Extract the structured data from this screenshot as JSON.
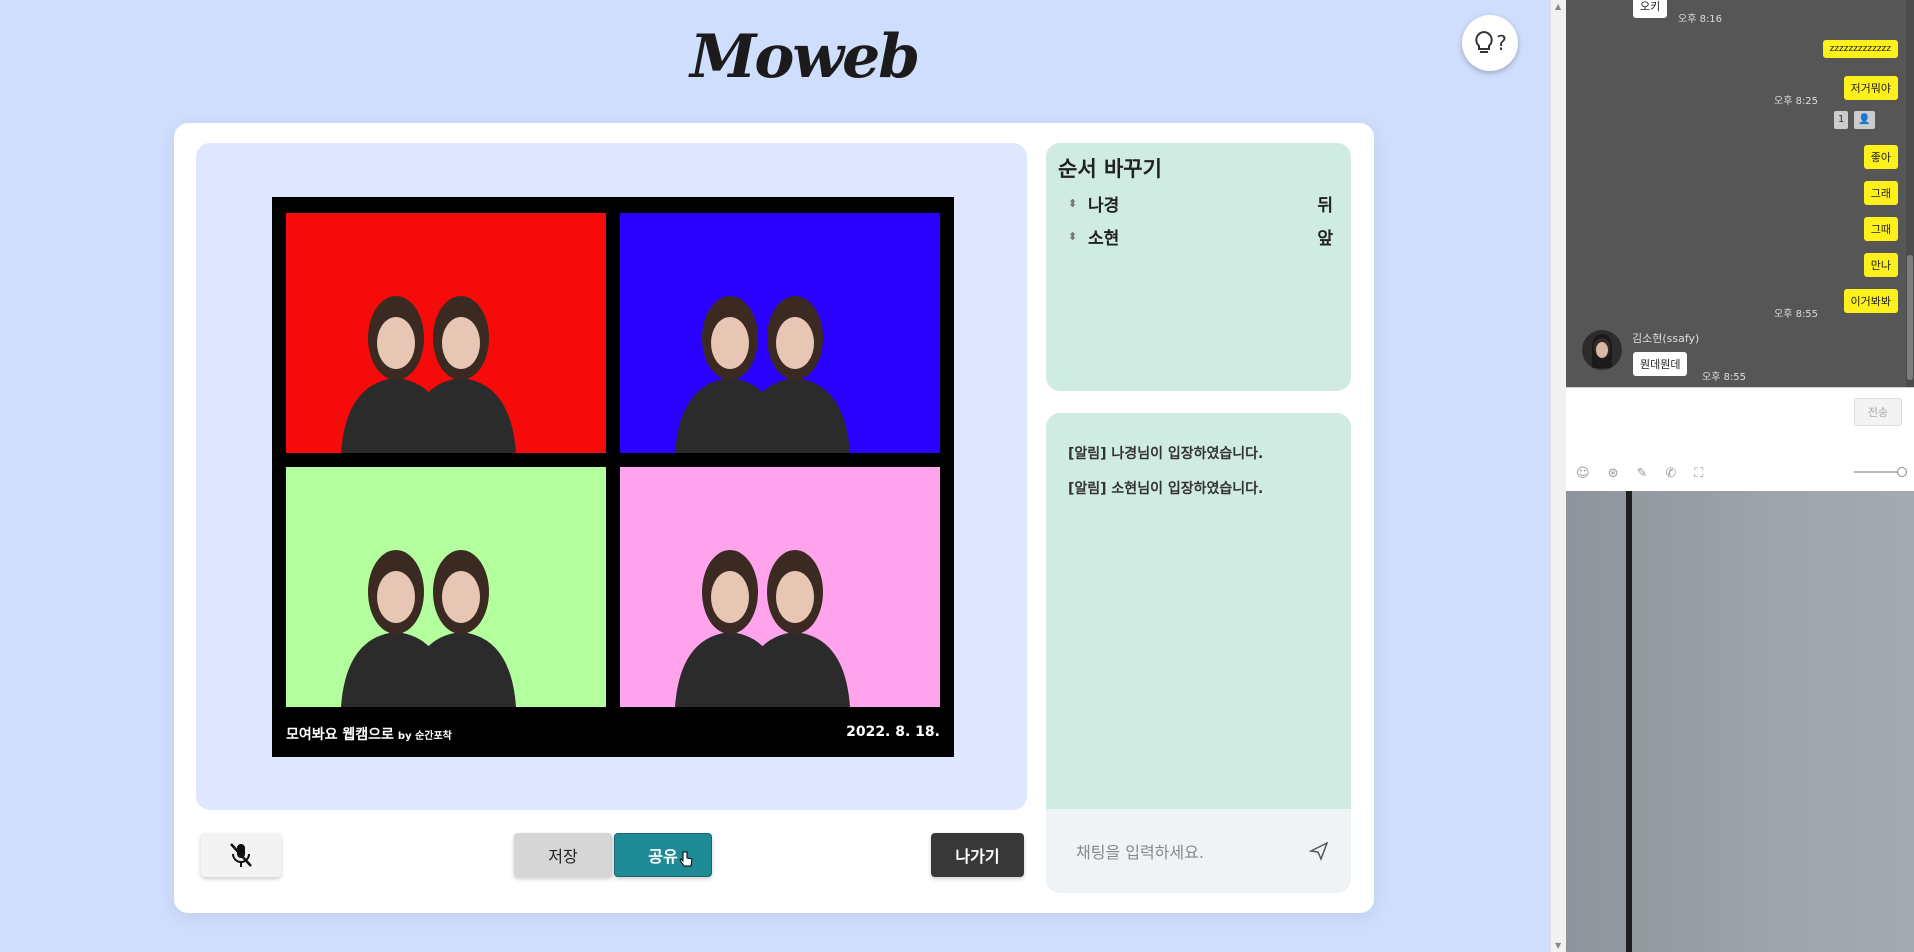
{
  "app": {
    "logo": "Moweb",
    "help_label": "?"
  },
  "photo": {
    "frame_title": "모여봐요 웹캠으로",
    "frame_subtitle": "by 순간포착",
    "date": "2022. 8. 18.",
    "backgrounds": [
      "#f60a0a",
      "#2a00ff",
      "#b3ff9e",
      "#ffa3ec"
    ]
  },
  "buttons": {
    "save": "저장",
    "share": "공유",
    "exit": "나가기"
  },
  "order": {
    "title": "순서 바꾸기",
    "rows": [
      {
        "name": "나경",
        "position": "뒤"
      },
      {
        "name": "소현",
        "position": "앞"
      }
    ]
  },
  "chat": {
    "messages": [
      "[알림] 나경님이 입장하였습니다.",
      "[알림] 소현님이 입장하였습니다."
    ],
    "placeholder": "채팅을 입력하세요."
  },
  "kakao": {
    "messages": [
      {
        "text": "오키",
        "time": "오후 8:16",
        "mine": false
      },
      {
        "text": "zzzzzzzzzzzzz",
        "time": "",
        "mine": true
      },
      {
        "text": "저거뭐야",
        "time": "오후 8:25",
        "mine": true
      },
      {
        "text": "좋아",
        "time": "",
        "mine": true
      },
      {
        "text": "그래",
        "time": "",
        "mine": true
      },
      {
        "text": "그때",
        "time": "",
        "mine": true
      },
      {
        "text": "만나",
        "time": "",
        "mine": true
      },
      {
        "text": "이거봐봐",
        "time": "오후 8:55",
        "mine": true
      },
      {
        "text": "뭔데뭔데",
        "time": "오후 8:55",
        "mine": false
      }
    ],
    "badge_count": "1",
    "sender": "김소현(ssafy)",
    "send_label": "전송"
  }
}
